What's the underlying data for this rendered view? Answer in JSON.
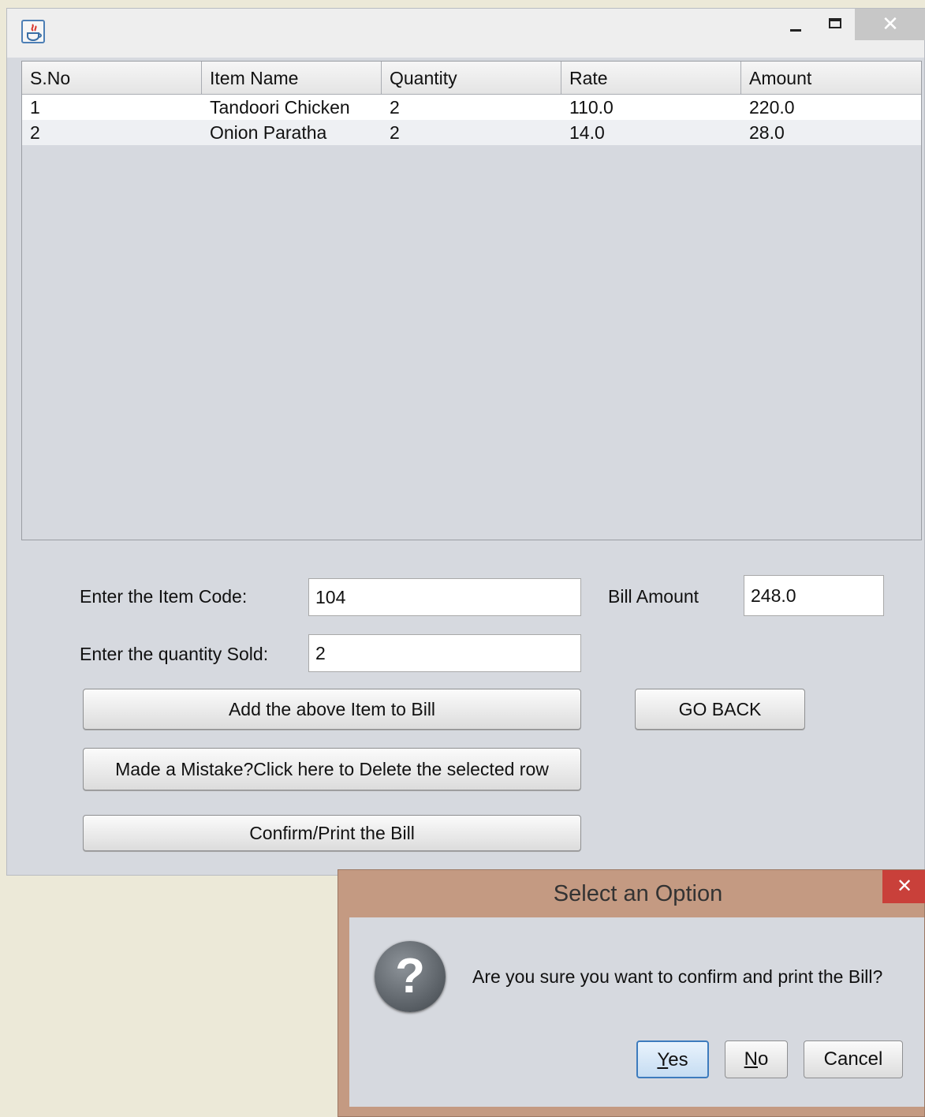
{
  "window": {
    "title": "",
    "controls": [
      "minimize-icon",
      "maximize-icon",
      "close-icon"
    ]
  },
  "table": {
    "columns": [
      "S.No",
      "Item Name",
      "Quantity",
      "Rate",
      "Amount"
    ],
    "rows": [
      [
        "1",
        "Tandoori Chicken",
        "2",
        "110.0",
        "220.0"
      ],
      [
        "2",
        "Onion Paratha",
        "2",
        "14.0",
        "28.0"
      ]
    ]
  },
  "form": {
    "item_code_label": "Enter the Item Code:",
    "item_code_value": "104",
    "quantity_label": "Enter the quantity Sold:",
    "quantity_value": "2",
    "bill_amount_label": "Bill Amount",
    "bill_amount_value": "248.0"
  },
  "buttons": {
    "add_item": "Add the above Item to Bill",
    "go_back": "GO BACK",
    "delete_row": "Made a Mistake?Click here to Delete the selected row",
    "confirm_print": "Confirm/Print the Bill"
  },
  "dialog": {
    "title": "Select an Option",
    "message": "Are you sure you want to confirm and print the Bill?",
    "icon": "question-icon",
    "yes_mnemonic": "Y",
    "yes_rest": "es",
    "no_mnemonic": "N",
    "no_rest": "o",
    "cancel_label": "Cancel"
  }
}
